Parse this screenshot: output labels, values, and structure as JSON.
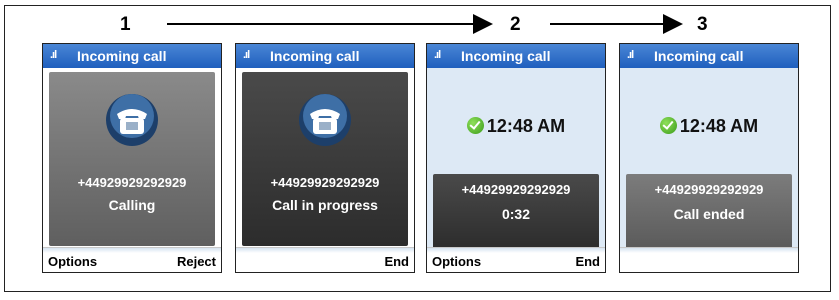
{
  "steps": [
    "1",
    "2",
    "3"
  ],
  "screens": [
    {
      "title": "Incoming call",
      "signal": ".ıl",
      "number": "+44929929292929",
      "status": "Calling",
      "left_softkey": "Options",
      "right_softkey": "Reject",
      "icon": "telephone-icon"
    },
    {
      "title": "Incoming call",
      "signal": ".ıl",
      "number": "+44929929292929",
      "status": "Call in progress",
      "left_softkey": "",
      "right_softkey": "End",
      "icon": "telephone-icon"
    },
    {
      "title": "Incoming call",
      "signal": ".ıl",
      "time": "12:48 AM",
      "number": "+44929929292929",
      "status": "0:32",
      "left_softkey": "Options",
      "right_softkey": "End",
      "icon": "check-icon"
    },
    {
      "title": "Incoming call",
      "signal": ".ıl",
      "time": "12:48 AM",
      "number": "+44929929292929",
      "status": "Call ended",
      "left_softkey": "",
      "right_softkey": "",
      "icon": "check-icon"
    }
  ],
  "colors": {
    "titlebar": "#2f6fcb",
    "panel_dark": "#333333",
    "panel_gray": "#6e6e6e",
    "screen_bg": "#dde9f5"
  }
}
